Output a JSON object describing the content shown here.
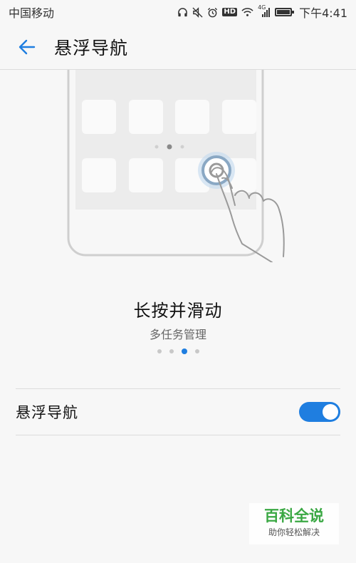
{
  "status_bar": {
    "carrier": "中国移动",
    "network_label": "4G",
    "hd_label": "HD",
    "time": "下午4:41",
    "icons": [
      "headset-icon",
      "mute-icon",
      "alarm-icon",
      "hd-icon",
      "wifi-icon",
      "signal-icon",
      "battery-icon"
    ]
  },
  "app_bar": {
    "back_icon": "arrow-left-icon",
    "title": "悬浮导航"
  },
  "tutorial": {
    "title": "长按并滑动",
    "subtitle": "多任务管理",
    "pages": 4,
    "active_page": 3
  },
  "setting": {
    "label": "悬浮导航",
    "enabled": true
  },
  "watermark": {
    "title": "百科全说",
    "subtitle": "助你轻松解决"
  },
  "colors": {
    "accent": "#1f7ee0",
    "background": "#f7f7f7",
    "watermark_green": "#3aa843"
  }
}
